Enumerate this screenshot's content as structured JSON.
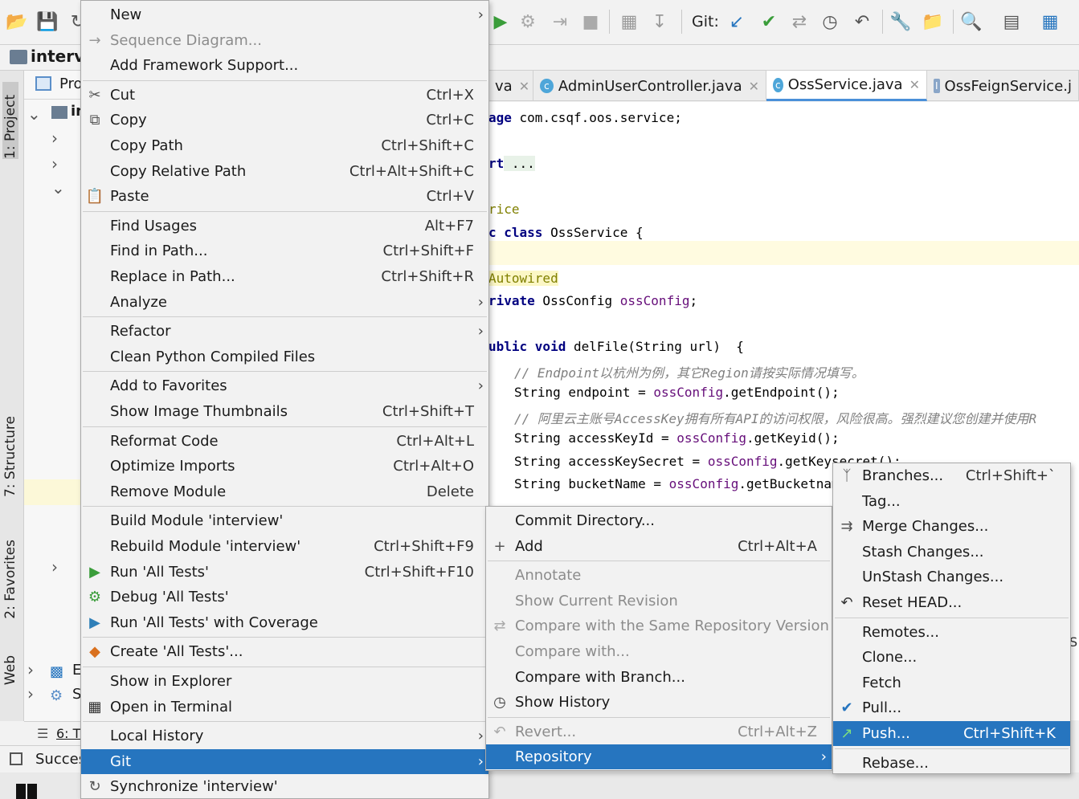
{
  "toolbar": {
    "git_label": "Git:",
    "icons": [
      "open-folder-icon",
      "save-icon",
      "sync-icon",
      "run-icon",
      "debug-icon",
      "step-icon",
      "stop-icon",
      "build-icon",
      "download-icon",
      "git-update-icon",
      "git-commit-icon",
      "git-compare-icon",
      "history-icon",
      "revert-icon",
      "wrench-icon",
      "project-structure-icon",
      "search-icon",
      "terminal-icon",
      "translate-icon"
    ]
  },
  "navbar": {
    "crumb": "intervi"
  },
  "left_stripe": {
    "tabs": [
      "1: Project",
      "7: Structure",
      "2: Favorites",
      "Web"
    ]
  },
  "project_panel": {
    "header": "Pro",
    "root_item": "in",
    "item_e": "E",
    "item_s": "S"
  },
  "editor_tabs": [
    {
      "label": "va",
      "closable": true
    },
    {
      "label": "AdminUserController.java",
      "closable": true
    },
    {
      "label": "OssService.java",
      "closable": true,
      "active": true
    },
    {
      "label": "OssFeignService.j",
      "closable": false
    }
  ],
  "code": {
    "l1_a": "age",
    "l1_b": " com.csqf.oos.service;",
    "l2_a": "rt",
    "l2_b": " ...",
    "l3": "rice",
    "l4_a": "c ",
    "l4_kw": "class",
    "l4_b": " OssService {",
    "l5": "Autowired",
    "l6_kw": "rivate",
    "l6_b": " OssConfig ",
    "l6_f": "ossConfig",
    "l6_c": ";",
    "l7_kw": "ublic void",
    "l7_b": " delFile(String url)  {",
    "l8": "// Endpoint以杭州为例，其它Region请按实际情况填写。",
    "l9_a": "String endpoint = ",
    "l9_f": "ossConfig",
    "l9_b": ".getEndpoint();",
    "l10": "// 阿里云主账号AccessKey拥有所有API的访问权限，风险很高。强烈建议您创建并使用R",
    "l11_a": "String accessKeyId = ",
    "l11_f": "ossConfig",
    "l11_b": ".getKeyid();",
    "l12_a": "String accessKeySecret = ",
    "l12_f": "ossConfig",
    "l12_b": ".getKeysecret();",
    "l13_a": "String bucketName = ",
    "l13_f": "ossConfig",
    "l13_b": ".getBucketname(",
    "edge_letters": "S"
  },
  "bottom": {
    "tool_label": "6: T",
    "status": "Succes"
  },
  "context_menu": [
    {
      "label": "New",
      "submenu": true
    },
    {
      "label": "Sequence Diagram...",
      "disabled": true,
      "icon": "sequence-icon"
    },
    {
      "label": "Add Framework Support..."
    },
    {
      "sep": true
    },
    {
      "label": "Cut",
      "shortcut": "Ctrl+X",
      "icon": "scissors-icon"
    },
    {
      "label": "Copy",
      "shortcut": "Ctrl+C",
      "icon": "copy-icon"
    },
    {
      "label": "Copy Path",
      "shortcut": "Ctrl+Shift+C"
    },
    {
      "label": "Copy Relative Path",
      "shortcut": "Ctrl+Alt+Shift+C"
    },
    {
      "label": "Paste",
      "shortcut": "Ctrl+V",
      "icon": "paste-icon"
    },
    {
      "sep": true
    },
    {
      "label": "Find Usages",
      "shortcut": "Alt+F7"
    },
    {
      "label": "Find in Path...",
      "shortcut": "Ctrl+Shift+F"
    },
    {
      "label": "Replace in Path...",
      "shortcut": "Ctrl+Shift+R"
    },
    {
      "label": "Analyze",
      "submenu": true
    },
    {
      "sep": true
    },
    {
      "label": "Refactor",
      "submenu": true
    },
    {
      "label": "Clean Python Compiled Files"
    },
    {
      "sep": true
    },
    {
      "label": "Add to Favorites",
      "submenu": true
    },
    {
      "label": "Show Image Thumbnails",
      "shortcut": "Ctrl+Shift+T"
    },
    {
      "sep": true
    },
    {
      "label": "Reformat Code",
      "shortcut": "Ctrl+Alt+L"
    },
    {
      "label": "Optimize Imports",
      "shortcut": "Ctrl+Alt+O"
    },
    {
      "label": "Remove Module",
      "shortcut": "Delete"
    },
    {
      "sep": true
    },
    {
      "label": "Build Module 'interview'"
    },
    {
      "label": "Rebuild Module 'interview'",
      "shortcut": "Ctrl+Shift+F9"
    },
    {
      "label": "Run 'All Tests'",
      "shortcut": "Ctrl+Shift+F10",
      "icon": "run-icon"
    },
    {
      "label": "Debug 'All Tests'",
      "icon": "debug-icon"
    },
    {
      "label": "Run 'All Tests' with Coverage",
      "icon": "coverage-icon"
    },
    {
      "sep": true
    },
    {
      "label": "Create 'All Tests'...",
      "icon": "create-test-icon"
    },
    {
      "sep": true
    },
    {
      "label": "Show in Explorer"
    },
    {
      "label": "Open in Terminal",
      "icon": "terminal-icon"
    },
    {
      "sep": true
    },
    {
      "label": "Local History",
      "submenu": true
    },
    {
      "label": "Git",
      "submenu": true,
      "selected": true
    },
    {
      "label": "Synchronize 'interview'",
      "icon": "sync-icon"
    }
  ],
  "repository_menu": [
    {
      "label": "Commit Directory..."
    },
    {
      "label": "Add",
      "shortcut": "Ctrl+Alt+A",
      "icon": "plus-icon"
    },
    {
      "sep": true
    },
    {
      "label": "Annotate",
      "disabled": true
    },
    {
      "label": "Show Current Revision",
      "disabled": true
    },
    {
      "label": "Compare with the Same Repository Version",
      "disabled": true,
      "icon": "compare-icon"
    },
    {
      "label": "Compare with...",
      "disabled": true
    },
    {
      "label": "Compare with Branch..."
    },
    {
      "label": "Show History",
      "icon": "clock-icon"
    },
    {
      "sep": true
    },
    {
      "label": "Revert...",
      "shortcut": "Ctrl+Alt+Z",
      "disabled": true,
      "icon": "revert-icon"
    },
    {
      "label": "Repository",
      "submenu": true,
      "selected": true
    }
  ],
  "git_menu": [
    {
      "label": "Branches...",
      "shortcut": "Ctrl+Shift+`",
      "icon": "branch-icon"
    },
    {
      "label": "Tag..."
    },
    {
      "label": "Merge Changes...",
      "icon": "merge-icon"
    },
    {
      "label": "Stash Changes..."
    },
    {
      "label": "UnStash Changes..."
    },
    {
      "label": "Reset HEAD...",
      "icon": "reset-icon"
    },
    {
      "sep": true
    },
    {
      "label": "Remotes..."
    },
    {
      "label": "Clone..."
    },
    {
      "label": "Fetch"
    },
    {
      "label": "Pull...",
      "icon": "pull-check-icon"
    },
    {
      "label": "Push...",
      "shortcut": "Ctrl+Shift+K",
      "selected": true,
      "icon": "push-arrow-icon"
    },
    {
      "sep": true
    },
    {
      "label": "Rebase..."
    }
  ],
  "colors": {
    "selection": "#2675bf",
    "menu_bg": "#f2f2f2",
    "disabled_text": "#8c8c8c"
  }
}
